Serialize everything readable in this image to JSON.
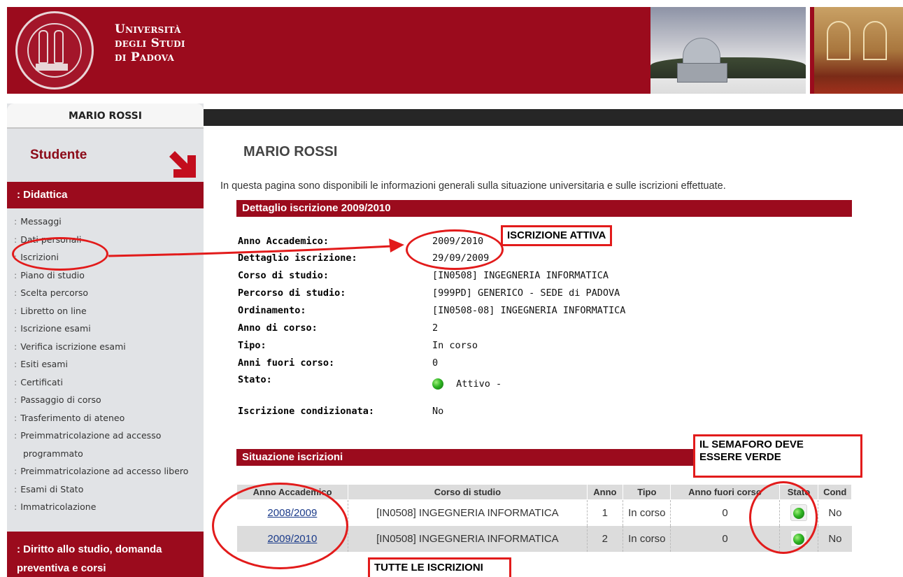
{
  "header": {
    "university_line1": "Università",
    "university_line2": "degli Studi",
    "university_line3": "di Padova"
  },
  "sidebar": {
    "user_name": "MARIO ROSSI",
    "role_title": "Studente",
    "section_didattica": ": Didattica",
    "items": [
      {
        "label": "Messaggi"
      },
      {
        "label": "Dati personali"
      },
      {
        "label": "Iscrizioni"
      },
      {
        "label": "Piano di studio"
      },
      {
        "label": "Scelta percorso"
      },
      {
        "label": "Libretto on line"
      },
      {
        "label": "Iscrizione esami"
      },
      {
        "label": "Verifica iscrizione esami"
      },
      {
        "label": "Esiti esami"
      },
      {
        "label": "Certificati"
      },
      {
        "label": "Passaggio di corso"
      },
      {
        "label": "Trasferimento di ateneo"
      },
      {
        "label": "Preimmatricolazione ad accesso programmato"
      },
      {
        "label": "Preimmatricolazione ad accesso libero"
      },
      {
        "label": "Esami di Stato"
      },
      {
        "label": "Immatricolazione"
      }
    ],
    "section_diritto": ": Diritto allo studio, domanda preventiva e corsi"
  },
  "main": {
    "title": "MARIO ROSSI",
    "intro": "In questa pagina sono disponibili le informazioni generali sulla situazione universitaria e sulle iscrizioni effettuate.",
    "detail_header": "Dettaglio iscrizione 2009/2010",
    "details": [
      {
        "label": "Anno Accademico:",
        "value": "2009/2010"
      },
      {
        "label": "Dettaglio iscrizione:",
        "value": "29/09/2009"
      },
      {
        "label": "Corso di studio:",
        "value": "[IN0508] INGEGNERIA INFORMATICA"
      },
      {
        "label": "Percorso di studio:",
        "value": "[999PD] GENERICO - SEDE di PADOVA"
      },
      {
        "label": "Ordinamento:",
        "value": "[IN0508-08] INGEGNERIA INFORMATICA"
      },
      {
        "label": "Anno di corso:",
        "value": "2"
      },
      {
        "label": "Tipo:",
        "value": "In corso"
      },
      {
        "label": "Anni fuori corso:",
        "value": "0"
      },
      {
        "label": "Stato:",
        "value": "Attivo -"
      },
      {
        "label": "Iscrizione condizionata:",
        "value": "No"
      }
    ],
    "status_color": "#2fb423",
    "situation_header": "Situazione iscrizioni",
    "table": {
      "columns": [
        "Anno Accademico",
        "Corso di studio",
        "Anno",
        "Tipo",
        "Anno fuori corso",
        "Stato",
        "Cond"
      ],
      "rows": [
        {
          "anno_accademico": "2008/2009",
          "corso": "[IN0508] INGEGNERIA INFORMATICA",
          "anno": "1",
          "tipo": "In corso",
          "fuori_corso": "0",
          "stato_icon": "green-light-icon",
          "cond": "No"
        },
        {
          "anno_accademico": "2009/2010",
          "corso": "[IN0508] INGEGNERIA INFORMATICA",
          "anno": "2",
          "tipo": "In corso",
          "fuori_corso": "0",
          "stato_icon": "green-light-icon",
          "cond": "No"
        }
      ]
    }
  },
  "annotations": {
    "iscrizione_attiva": "ISCRIZIONE ATTIVA",
    "semaforo_line1": "IL SEMAFORO DEVE",
    "semaforo_line2": "ESSERE VERDE",
    "tutte": "TUTTE LE ISCRIZIONI",
    "accent_color": "#e21b1b"
  },
  "colors": {
    "brand_red": "#9b0b1d",
    "sidebar_bg": "#e1e3e6"
  }
}
